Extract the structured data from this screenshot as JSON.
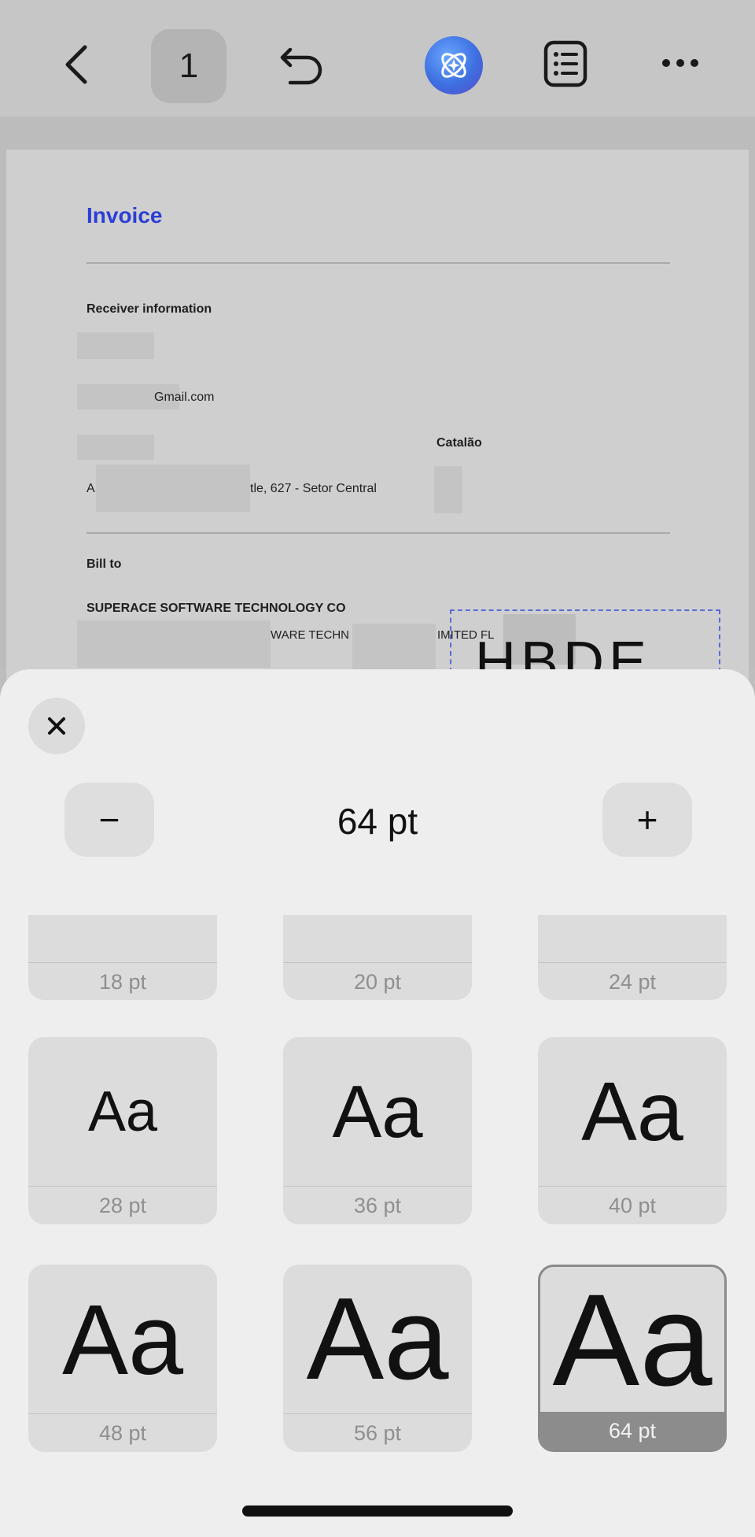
{
  "toolbar": {
    "page_number": "1",
    "icons": [
      "back-icon",
      "undo-icon",
      "ai-assistant-icon",
      "list-icon",
      "more-icon"
    ]
  },
  "document": {
    "title": "Invoice",
    "receiver_heading": "Receiver information",
    "email_fragment": "Gmail.com",
    "city": "Catalão",
    "address_prefix": "A",
    "address_fragment": "tle, 627 - Setor Central",
    "bill_to_heading": "Bill to",
    "company": "SUPERACE SOFTWARE TECHNOLOGY CO",
    "company_line2_a": "WARE TECHN",
    "company_line2_b": "IMITED FL",
    "selected_text_fragment": "HBDE",
    "colors": {
      "title": "#2b3fd6",
      "selection_border": "#5a6ad8"
    }
  },
  "font_size_sheet": {
    "current_value": "64 pt",
    "minus_label": "−",
    "plus_label": "+",
    "sample_text": "Aa",
    "sizes": [
      {
        "label": "18 pt"
      },
      {
        "label": "20 pt"
      },
      {
        "label": "24 pt"
      },
      {
        "label": "28 pt"
      },
      {
        "label": "36 pt"
      },
      {
        "label": "40 pt"
      },
      {
        "label": "48 pt"
      },
      {
        "label": "56 pt"
      },
      {
        "label": "64 pt",
        "selected": true
      }
    ]
  }
}
